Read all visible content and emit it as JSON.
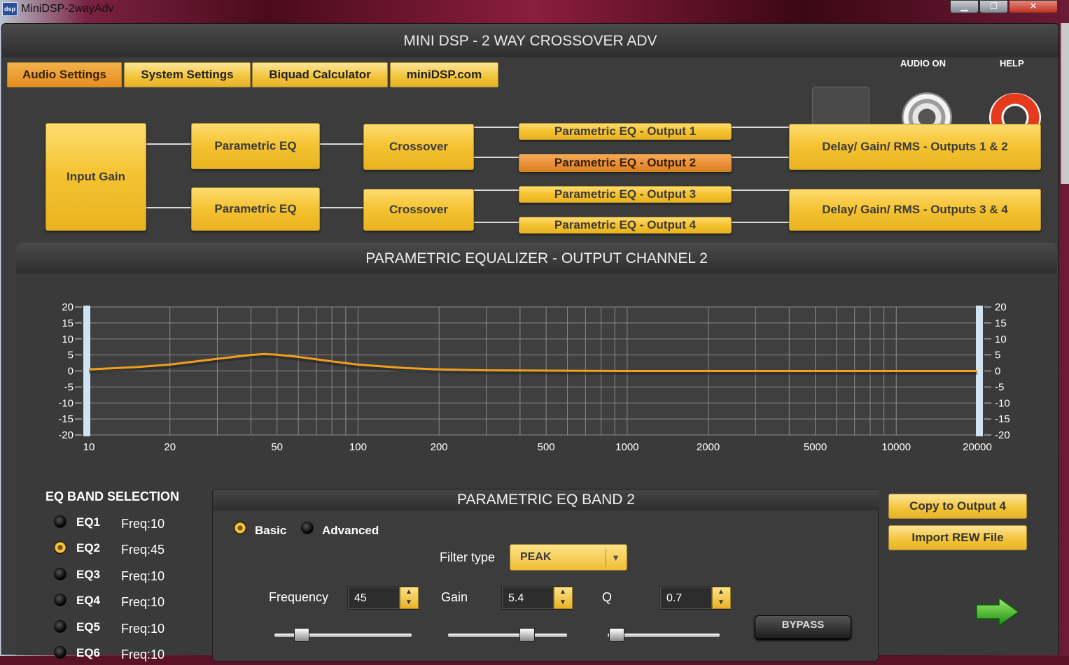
{
  "window": {
    "title": "MiniDSP-2wayAdv",
    "icon": "dsp",
    "controls": {
      "minimize": "▁",
      "maximize": "☐",
      "close": "✕"
    }
  },
  "app": {
    "header": "MINI DSP - 2 WAY CROSSOVER ADV"
  },
  "tabs": [
    "Audio Settings",
    "System Settings",
    "Biquad Calculator",
    "miniDSP.com"
  ],
  "blocks": {
    "input_gain": "Input Gain",
    "peq1": "Parametric EQ",
    "peq2": "Parametric EQ",
    "xover1": "Crossover",
    "xover2": "Crossover",
    "out1": "Parametric EQ - Output 1",
    "out2": "Parametric EQ - Output 2",
    "out3": "Parametric EQ - Output 3",
    "out4": "Parametric EQ - Output 4",
    "delay12": "Delay/ Gain/ RMS - Outputs 1 & 2",
    "delay34": "Delay/ Gain/ RMS - Outputs 3 & 4"
  },
  "audio_label": "AUDIO ON",
  "help_label": "HELP",
  "eq_title": "PARAMETRIC EQUALIZER - OUTPUT CHANNEL 2",
  "chart_data": {
    "type": "line",
    "x_scale": "log",
    "xlim": [
      10,
      20000
    ],
    "ylim": [
      -20,
      20
    ],
    "x_ticks": [
      10,
      20,
      50,
      100,
      200,
      500,
      1000,
      2000,
      5000,
      10000,
      20000
    ],
    "y_ticks": [
      20,
      15,
      10,
      5,
      0,
      -5,
      -10,
      -15,
      -20
    ],
    "grid": true,
    "line_color": "#f0a01a",
    "series": [
      {
        "x": [
          10,
          15,
          20,
          30,
          40,
          45,
          50,
          60,
          80,
          100,
          150,
          200,
          300,
          500,
          1000,
          2000,
          5000,
          10000,
          20000
        ],
        "y": [
          0.5,
          1.2,
          2.0,
          3.8,
          5.0,
          5.3,
          5.1,
          4.4,
          3.0,
          2.0,
          0.9,
          0.5,
          0.2,
          0.1,
          0,
          0,
          0,
          0,
          0
        ]
      }
    ]
  },
  "band_selection": {
    "title": "EQ BAND SELECTION",
    "bands": [
      {
        "name": "EQ1",
        "freq": "Freq:10"
      },
      {
        "name": "EQ2",
        "freq": "Freq:45"
      },
      {
        "name": "EQ3",
        "freq": "Freq:10"
      },
      {
        "name": "EQ4",
        "freq": "Freq:10"
      },
      {
        "name": "EQ5",
        "freq": "Freq:10"
      },
      {
        "name": "EQ6",
        "freq": "Freq:10"
      }
    ],
    "selected": "EQ2"
  },
  "band_panel": {
    "title": "PARAMETRIC EQ BAND 2",
    "mode_basic": "Basic",
    "mode_advanced": "Advanced",
    "mode_selected": "Basic",
    "filter_label": "Filter type",
    "filter_value": "PEAK",
    "freq_label": "Frequency",
    "freq_value": "45",
    "gain_label": "Gain",
    "gain_value": "5.4",
    "q_label": "Q",
    "q_value": "0.7",
    "bypass": "BYPASS"
  },
  "actions": {
    "copy": "Copy to Output 4",
    "import": "Import REW File"
  }
}
